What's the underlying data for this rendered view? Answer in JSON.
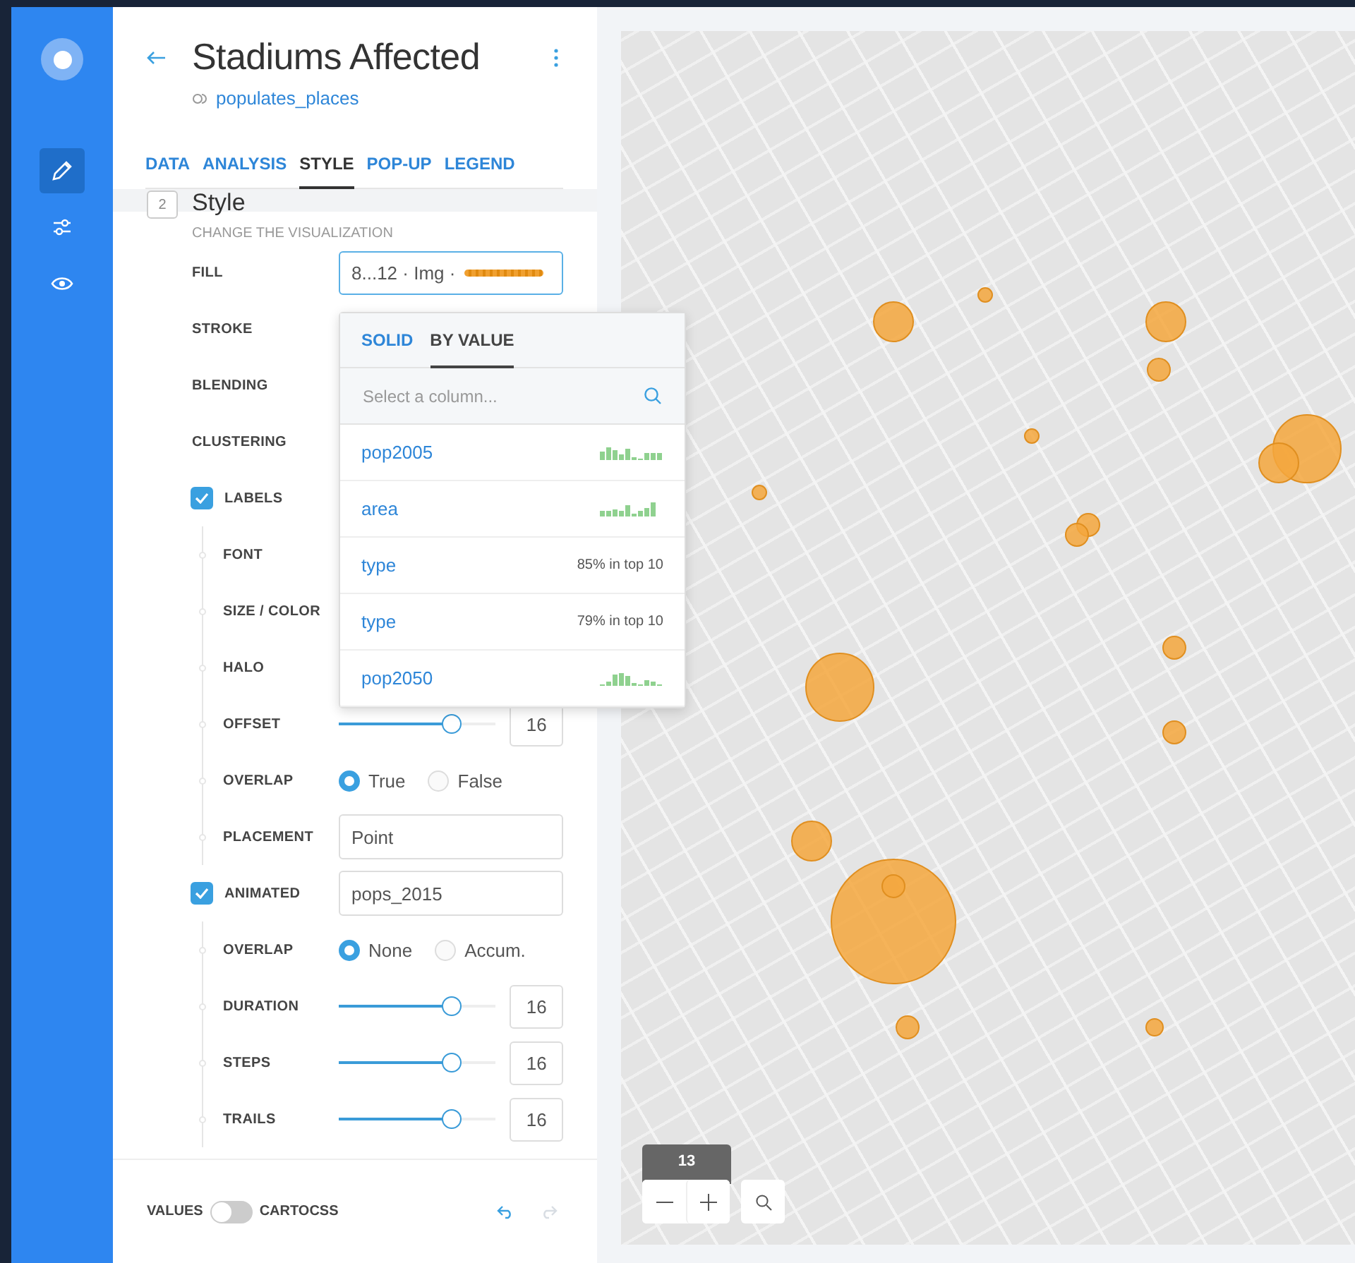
{
  "sidebar": {
    "items": [
      {
        "kind": "edit",
        "selected": true
      },
      {
        "kind": "sliders",
        "selected": false
      },
      {
        "kind": "view",
        "selected": false
      }
    ]
  },
  "header": {
    "title": "Stadiums Affected",
    "source": "populates_places"
  },
  "tabs": [
    {
      "label": "DATA",
      "selected": false
    },
    {
      "label": "ANALYSIS",
      "selected": false
    },
    {
      "label": "STYLE",
      "selected": true
    },
    {
      "label": "POP-UP",
      "selected": false
    },
    {
      "label": "LEGEND",
      "selected": false
    }
  ],
  "section": {
    "number": "2",
    "title": "Style",
    "subtitle": "CHANGE THE VISUALIZATION"
  },
  "rows": [
    {
      "label": "FILL",
      "kind": "fill",
      "value": "8...12 · Img ·"
    },
    {
      "label": "STROKE",
      "kind": "plain"
    },
    {
      "label": "BLENDING",
      "kind": "plain"
    },
    {
      "label": "CLUSTERING",
      "kind": "plain"
    },
    {
      "label": "LABELS",
      "kind": "check",
      "checked": true,
      "children": [
        {
          "label": "FONT",
          "kind": "plain"
        },
        {
          "label": "SIZE / COLOR",
          "kind": "plain"
        },
        {
          "label": "HALO",
          "kind": "plain"
        },
        {
          "label": "OFFSET",
          "kind": "slider",
          "level": 0.72,
          "value": "16"
        },
        {
          "label": "OVERLAP",
          "kind": "radio",
          "options": [
            {
              "label": "True",
              "selected": true
            },
            {
              "label": "False",
              "selected": false
            }
          ]
        },
        {
          "label": "PLACEMENT",
          "kind": "input",
          "value": "Point"
        }
      ]
    },
    {
      "label": "ANIMATED",
      "kind": "check",
      "checked": true,
      "value": "pops_2015",
      "children": [
        {
          "label": "OVERLAP",
          "kind": "radio",
          "options": [
            {
              "label": "None",
              "selected": true
            },
            {
              "label": "Accum.",
              "selected": false
            }
          ]
        },
        {
          "label": "DURATION",
          "kind": "slider",
          "level": 0.72,
          "value": "16"
        },
        {
          "label": "STEPS",
          "kind": "slider",
          "level": 0.72,
          "value": "16"
        },
        {
          "label": "TRAILS",
          "kind": "slider",
          "level": 0.72,
          "value": "16"
        }
      ]
    }
  ],
  "dropdown": {
    "tabs": [
      {
        "label": "SOLID",
        "selected": false
      },
      {
        "label": "BY VALUE",
        "selected": true
      }
    ],
    "placeholder": "Select a column...",
    "columns": [
      {
        "name": "pop2005",
        "kind": "histogram"
      },
      {
        "name": "area",
        "kind": "histogram"
      },
      {
        "name": "type",
        "kind": "stat",
        "stat": "85% in top 10"
      },
      {
        "name": "type",
        "kind": "stat",
        "stat": "79% in top 10"
      },
      {
        "name": "pop2050",
        "kind": "histogram"
      }
    ]
  },
  "footer": {
    "left_label": "VALUES",
    "right_label": "CARTOCSS",
    "toggle_on": false
  },
  "map": {
    "zoom": "13"
  }
}
